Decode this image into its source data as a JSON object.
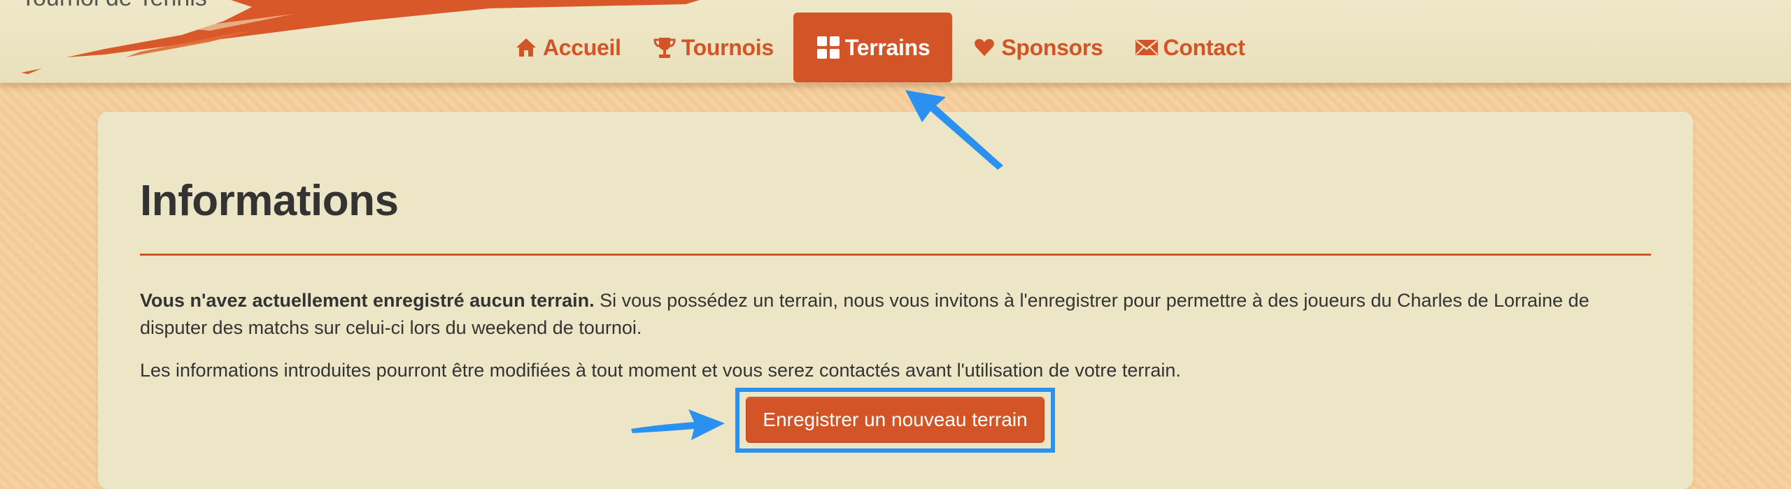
{
  "navbar": {
    "brand_text": "Tournoi de Tennis",
    "items": [
      {
        "label": "Accueil",
        "icon": "home-icon",
        "active": false
      },
      {
        "label": "Tournois",
        "icon": "trophy-icon",
        "active": false
      },
      {
        "label": "Terrains",
        "icon": "grid-icon",
        "active": true
      },
      {
        "label": "Sponsors",
        "icon": "heart-icon",
        "active": false
      },
      {
        "label": "Contact",
        "icon": "envelope-icon",
        "active": false
      }
    ]
  },
  "main": {
    "title": "Informations",
    "notice_bold": "Vous n'avez actuellement enregistré aucun terrain.",
    "notice_text": " Si vous possédez un terrain, nous vous invitons à l'enregistrer pour permettre à des joueurs du Charles de Lorraine de disputer des matchs sur celui-ci lors du weekend de tournoi.",
    "info_text": "Les informations introduites pourront être modifiées à tout moment et vous serez contactés avant l'utilisation de votre terrain.",
    "register_button": "Enregistrer un nouveau terrain"
  },
  "colors": {
    "accent": "#d35427",
    "background": "#f7cf9e",
    "card": "#ede6c6",
    "annotation": "#2a91f0"
  }
}
